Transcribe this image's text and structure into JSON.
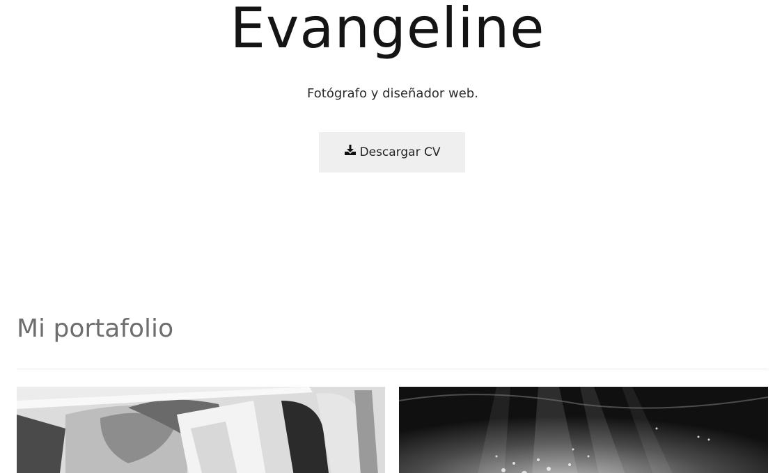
{
  "hero": {
    "title": "Evangeline",
    "subtitle": "Fotógrafo y diseñador web.",
    "cv_button_label": "Descargar CV",
    "cv_button_icon": "download-icon"
  },
  "portfolio": {
    "heading": "Mi portafolio"
  }
}
